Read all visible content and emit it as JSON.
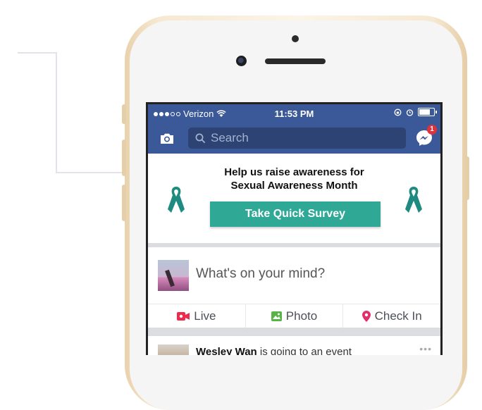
{
  "status_bar": {
    "carrier": "Verizon",
    "time": "11:53 PM"
  },
  "nav": {
    "search_placeholder": "Search",
    "messenger_badge": "1"
  },
  "awareness_card": {
    "line1": "Help us raise awareness for",
    "line2": "Sexual Awareness Month",
    "button_label": "Take Quick Survey",
    "ribbon_color": "#1f8b80"
  },
  "composer": {
    "prompt": "What's on your mind?",
    "actions": [
      {
        "label": "Live",
        "icon": "live-video-icon",
        "color": "#f02849"
      },
      {
        "label": "Photo",
        "icon": "photo-icon",
        "color": "#58b347"
      },
      {
        "label": "Check In",
        "icon": "location-pin-icon",
        "color": "#e42d6c"
      }
    ]
  },
  "feed": {
    "event_user": "Wesley Wan",
    "event_text": "is going to an event"
  },
  "colors": {
    "facebook_blue": "#3b5998",
    "survey_button": "#2fa896"
  }
}
